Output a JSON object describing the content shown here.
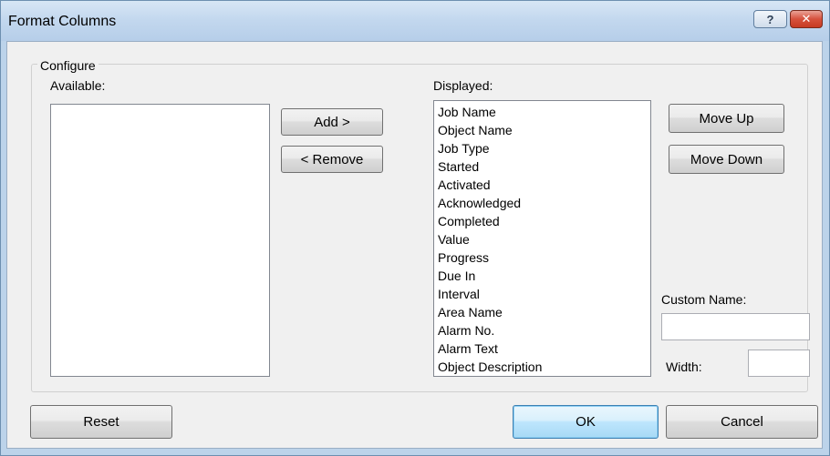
{
  "window": {
    "title": "Format Columns",
    "help_glyph": "?",
    "close_glyph": "✕"
  },
  "configure": {
    "group_label": "Configure",
    "available_label": "Available:",
    "displayed_label": "Displayed:",
    "available_items": [],
    "displayed_items": [
      "Job Name",
      "Object Name",
      "Job Type",
      "Started",
      "Activated",
      "Acknowledged",
      "Completed",
      "Value",
      "Progress",
      "Due In",
      "Interval",
      "Area Name",
      "Alarm No.",
      "Alarm Text",
      "Object Description"
    ],
    "add_label": "Add >",
    "remove_label": "< Remove",
    "move_up_label": "Move Up",
    "move_down_label": "Move Down",
    "custom_name_label": "Custom Name:",
    "custom_name_value": "",
    "width_label": "Width:",
    "width_value": ""
  },
  "footer": {
    "reset_label": "Reset",
    "ok_label": "OK",
    "cancel_label": "Cancel"
  },
  "colors": {
    "title_bar": "#c2d7ee",
    "close_button": "#d6513c",
    "default_button_border": "#3c7fb1"
  }
}
